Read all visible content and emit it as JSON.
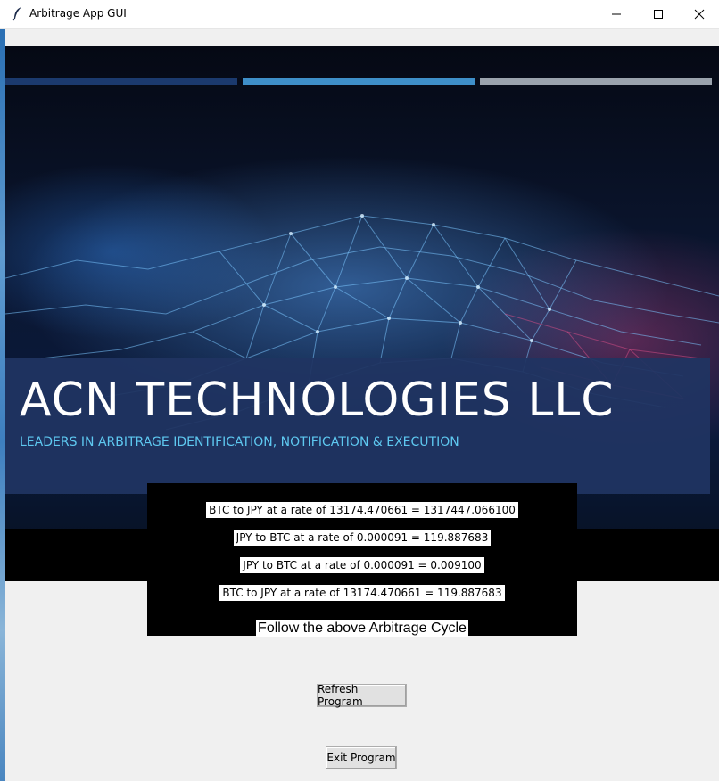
{
  "window": {
    "title": "Arbitrage App GUI",
    "icon": "feather-icon",
    "controls": [
      "minimize",
      "maximize",
      "close"
    ]
  },
  "banner": {
    "company_name": "ACN TECHNOLOGIES LLC",
    "tagline": "LEADERS IN ARBITRAGE IDENTIFICATION, NOTIFICATION & EXECUTION",
    "stripe_colors": [
      "#1b3a6e",
      "#3e8fc9",
      "#9aa3ad"
    ]
  },
  "results": {
    "lines": [
      "BTC to JPY at a rate of 13174.470661 = 1317447.066100",
      "JPY to BTC at a rate of 0.000091 = 119.887683",
      "JPY to BTC at a rate of 0.000091 = 0.009100",
      "BTC to JPY at a rate of 13174.470661 = 119.887683"
    ],
    "instruction": "Follow the above Arbitrage Cycle"
  },
  "buttons": {
    "refresh_label": "Refresh Program",
    "exit_label": "Exit Program"
  },
  "colors": {
    "panel_bg": "#203462",
    "tagline": "#5ec8f0",
    "window_bg": "#f0f0f0"
  }
}
